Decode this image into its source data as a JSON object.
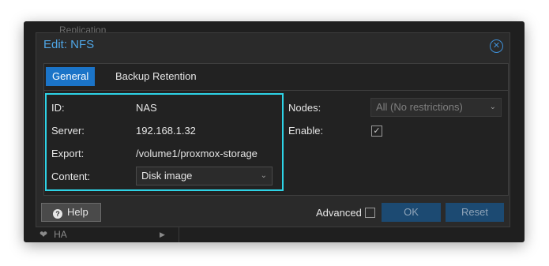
{
  "background": {
    "top_hint": "Replication",
    "bottom_item": "HA",
    "bottom_icon": "heart-icon"
  },
  "dialog": {
    "title": "Edit: NFS",
    "close_icon": "close-circle-icon"
  },
  "tabs": [
    {
      "label": "General",
      "active": true
    },
    {
      "label": "Backup Retention",
      "active": false
    }
  ],
  "form": {
    "id_label": "ID:",
    "id_value": "NAS",
    "server_label": "Server:",
    "server_value": "192.168.1.32",
    "export_label": "Export:",
    "export_value": "/volume1/proxmox-storage",
    "content_label": "Content:",
    "content_value": "Disk image",
    "nodes_label": "Nodes:",
    "nodes_value": "All (No restrictions)",
    "enable_label": "Enable:",
    "enable_checked": true
  },
  "footer": {
    "help_label": "Help",
    "advanced_label": "Advanced",
    "advanced_checked": false,
    "ok_label": "OK",
    "reset_label": "Reset"
  },
  "colors": {
    "accent": "#1b74c8",
    "title": "#4fa6e6",
    "highlight": "#2ed3e6",
    "background": "#2a2a2a"
  }
}
